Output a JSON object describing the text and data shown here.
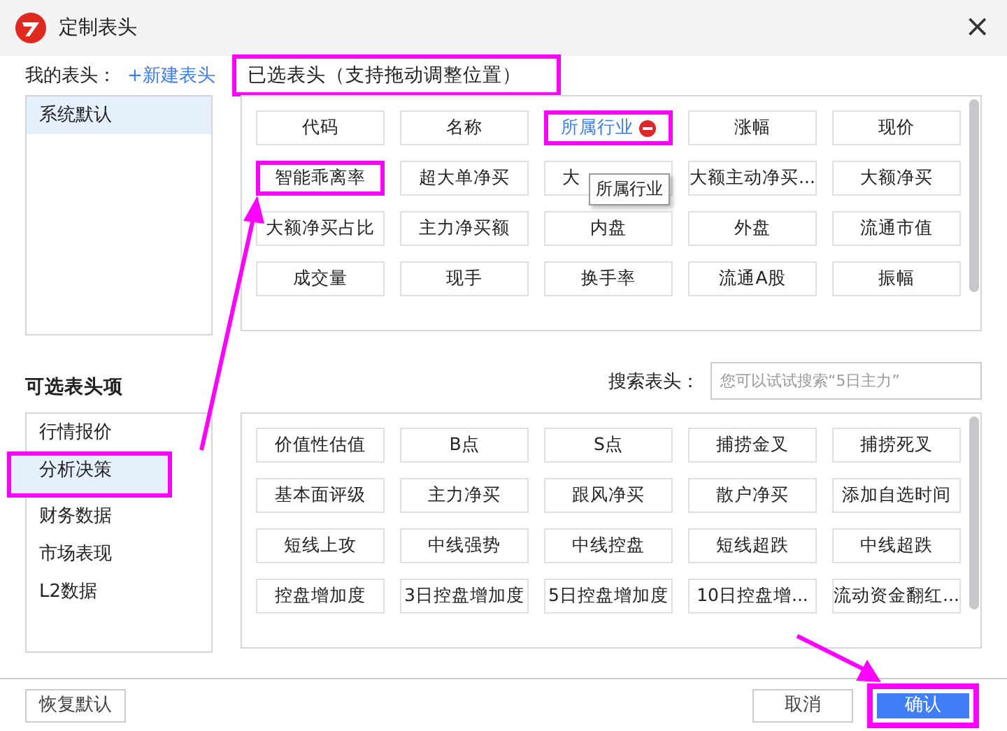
{
  "window": {
    "title": "定制表头",
    "close": "×"
  },
  "my_headers": {
    "label": "我的表头：",
    "new_link": "+新建表头",
    "items": [
      {
        "label": "系统默认",
        "selected": true
      }
    ]
  },
  "selected_headers": {
    "label": "已选表头（支持拖动调整位置）",
    "highlighted": true,
    "tooltip": "所属行业",
    "items": [
      {
        "label": "代码",
        "hovered": false,
        "highlighted": false,
        "covered": false
      },
      {
        "label": "名称",
        "hovered": false,
        "highlighted": false,
        "covered": false
      },
      {
        "label": "所属行业",
        "hovered": true,
        "highlighted": true,
        "covered": false
      },
      {
        "label": "涨幅",
        "hovered": false,
        "highlighted": false,
        "covered": false
      },
      {
        "label": "现价",
        "hovered": false,
        "highlighted": false,
        "covered": false
      },
      {
        "label": "智能乖离率",
        "hovered": false,
        "highlighted": true,
        "covered": false
      },
      {
        "label": "超大单净买",
        "hovered": false,
        "highlighted": false,
        "covered": false
      },
      {
        "label": "大",
        "hovered": false,
        "highlighted": false,
        "covered": true
      },
      {
        "label": "大额主动净买...",
        "hovered": false,
        "highlighted": false,
        "covered": false
      },
      {
        "label": "大额净买",
        "hovered": false,
        "highlighted": false,
        "covered": false
      },
      {
        "label": "大额净买占比",
        "hovered": false,
        "highlighted": false,
        "covered": false
      },
      {
        "label": "主力净买额",
        "hovered": false,
        "highlighted": false,
        "covered": false
      },
      {
        "label": "内盘",
        "hovered": false,
        "highlighted": false,
        "covered": false
      },
      {
        "label": "外盘",
        "hovered": false,
        "highlighted": false,
        "covered": false
      },
      {
        "label": "流通市值",
        "hovered": false,
        "highlighted": false,
        "covered": false
      },
      {
        "label": "成交量",
        "hovered": false,
        "highlighted": false,
        "covered": false
      },
      {
        "label": "现手",
        "hovered": false,
        "highlighted": false,
        "covered": false
      },
      {
        "label": "换手率",
        "hovered": false,
        "highlighted": false,
        "covered": false
      },
      {
        "label": "流通A股",
        "hovered": false,
        "highlighted": false,
        "covered": false
      },
      {
        "label": "振幅",
        "hovered": false,
        "highlighted": false,
        "covered": false
      }
    ]
  },
  "optional": {
    "label": "可选表头项",
    "search_label": "搜索表头：",
    "search": {
      "placeholder": "您可以试试搜索“5日主力”"
    },
    "categories": [
      {
        "label": "行情报价",
        "selected": false,
        "highlighted": false
      },
      {
        "label": "分析决策",
        "selected": true,
        "highlighted": true
      },
      {
        "label": "财务数据",
        "selected": false,
        "highlighted": false
      },
      {
        "label": "市场表现",
        "selected": false,
        "highlighted": false
      },
      {
        "label": "L2数据",
        "selected": false,
        "highlighted": false
      }
    ],
    "items": [
      {
        "label": "价值性估值",
        "hovered": false,
        "highlighted": false,
        "covered": false
      },
      {
        "label": "B点",
        "hovered": false,
        "highlighted": false,
        "covered": false
      },
      {
        "label": "S点",
        "hovered": false,
        "highlighted": false,
        "covered": false
      },
      {
        "label": "捕捞金叉",
        "hovered": false,
        "highlighted": false,
        "covered": false
      },
      {
        "label": "捕捞死叉",
        "hovered": false,
        "highlighted": false,
        "covered": false
      },
      {
        "label": "基本面评级",
        "hovered": false,
        "highlighted": false,
        "covered": false
      },
      {
        "label": "主力净买",
        "hovered": false,
        "highlighted": false,
        "covered": false
      },
      {
        "label": "跟风净买",
        "hovered": false,
        "highlighted": false,
        "covered": false
      },
      {
        "label": "散户净买",
        "hovered": false,
        "highlighted": false,
        "covered": false
      },
      {
        "label": "添加自选时间",
        "hovered": false,
        "highlighted": false,
        "covered": false
      },
      {
        "label": "短线上攻",
        "hovered": false,
        "highlighted": false,
        "covered": false
      },
      {
        "label": "中线强势",
        "hovered": false,
        "highlighted": false,
        "covered": false
      },
      {
        "label": "中线控盘",
        "hovered": false,
        "highlighted": false,
        "covered": false
      },
      {
        "label": "短线超跌",
        "hovered": false,
        "highlighted": false,
        "covered": false
      },
      {
        "label": "中线超跌",
        "hovered": false,
        "highlighted": false,
        "covered": false
      },
      {
        "label": "控盘增加度",
        "hovered": false,
        "highlighted": false,
        "covered": false
      },
      {
        "label": "3日控盘增加度",
        "hovered": false,
        "highlighted": false,
        "covered": false
      },
      {
        "label": "5日控盘增加度",
        "hovered": false,
        "highlighted": false,
        "covered": false
      },
      {
        "label": "10日控盘增...",
        "hovered": false,
        "highlighted": false,
        "covered": false
      },
      {
        "label": "流动资金翻红...",
        "hovered": false,
        "highlighted": false,
        "covered": false
      }
    ]
  },
  "buttons": [
    {
      "label": "恢复默认",
      "kind": "plain",
      "highlighted": false
    },
    {
      "label": "取消",
      "kind": "plain",
      "highlighted": false
    },
    {
      "label": "确认",
      "kind": "primary",
      "highlighted": true
    }
  ]
}
